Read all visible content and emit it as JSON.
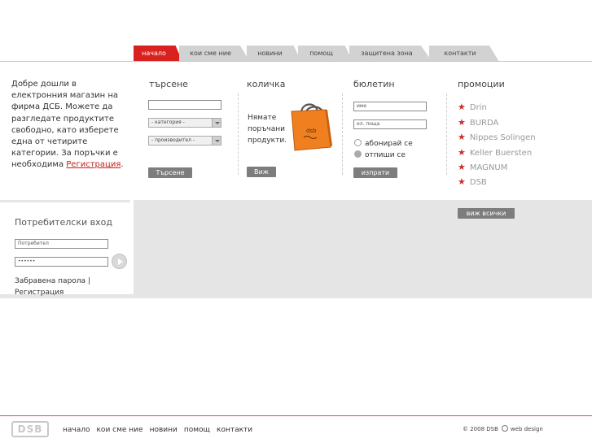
{
  "nav": {
    "tabs": [
      {
        "label": "начало",
        "active": true
      },
      {
        "label": "кои сме ние"
      },
      {
        "label": "новини"
      },
      {
        "label": "помощ"
      },
      {
        "label": "защитена зона"
      },
      {
        "label": "контакти"
      }
    ]
  },
  "welcome": {
    "text": "Добре дошли в електронния магазин на фирма ДСБ. Можете да разгледате продуктите свободно, като изберете една от четирите категории. За поръчки е необходима ",
    "register_link": "Регистрация",
    "suffix": "."
  },
  "search": {
    "title": "търсене",
    "input_value": "",
    "category_select": "- категория -",
    "manufacturer_select": "- производител -",
    "button": "Търсене"
  },
  "cart": {
    "title": "количка",
    "empty_text": "Нямате поръчани продукти.",
    "bag_label": "dsb",
    "button": "Виж"
  },
  "newsletter": {
    "title": "бюлетин",
    "name_placeholder": "име",
    "email_placeholder": "ел. поща",
    "subscribe_label": "абонирай се",
    "unsubscribe_label": "отпиши се",
    "button": "изпрати"
  },
  "promotions": {
    "title": "промоции",
    "items": [
      "Drin",
      "BURDA",
      "Nippes Solingen",
      "Keller Buersten",
      "MAGNUM",
      "DSB"
    ],
    "view_all": "виж всички"
  },
  "login": {
    "title": "Потребителски вход",
    "username_value": "Потребител",
    "password_value": "••••••",
    "forgot_link": "Забравена парола",
    "separator": "|",
    "register_link": "Регистрация"
  },
  "footer": {
    "logo_text": "DSB",
    "links": [
      "начало",
      "кои сме ние",
      "новини",
      "помощ",
      "контакти"
    ],
    "copyright": "© 2008 DSB",
    "webdesign": "web design"
  },
  "colors": {
    "accent": "#d9221f",
    "tab_inactive": "#d2d2d2",
    "button_gray": "#7d7d7d",
    "band_gray": "#e5e5e5",
    "bag_orange": "#f07f1f"
  }
}
